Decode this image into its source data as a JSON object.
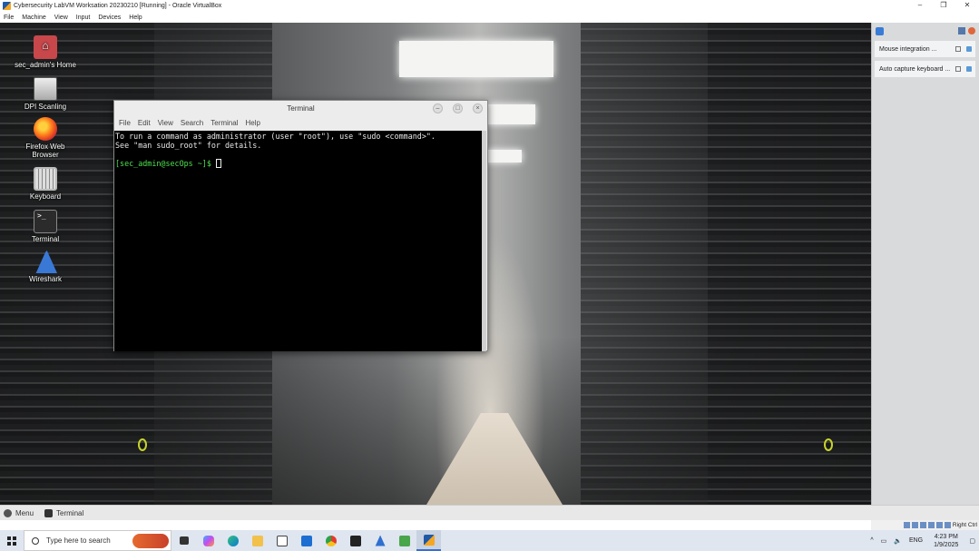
{
  "window": {
    "title": "Cybersecurity LabVM Worksation 20230210 [Running] - Oracle VirtualBox",
    "controls": [
      "–",
      "❐",
      "✕"
    ],
    "menu": [
      "File",
      "Machine",
      "View",
      "Input",
      "Devices",
      "Help"
    ]
  },
  "desktop": {
    "icons": [
      {
        "label": "sec_admin's Home"
      },
      {
        "label": "DPI Scanling"
      },
      {
        "label": "Firefox Web Browser"
      },
      {
        "label": "Keyboard"
      },
      {
        "label": "Terminal"
      },
      {
        "label": "Wireshark"
      }
    ]
  },
  "terminal": {
    "title": "Terminal",
    "menu": [
      "File",
      "Edit",
      "View",
      "Search",
      "Terminal",
      "Help"
    ],
    "lines": [
      "To run a command as administrator (user \"root\"), use \"sudo <command>\".",
      "See \"man sudo_root\" for details."
    ],
    "prompt": "[sec_admin@secOps ~]$ "
  },
  "guest_panel": {
    "menu_label": "Menu",
    "task_label": "Terminal"
  },
  "notifications": [
    {
      "text": "Mouse integration ..."
    },
    {
      "text": "Auto capture keyboard ..."
    }
  ],
  "vb_status": {
    "host_key": "Right Ctrl"
  },
  "taskbar": {
    "search_placeholder": "Type here to search",
    "tray_lang": "ENG",
    "time": "4:23 PM",
    "date": "1/9/2025"
  }
}
